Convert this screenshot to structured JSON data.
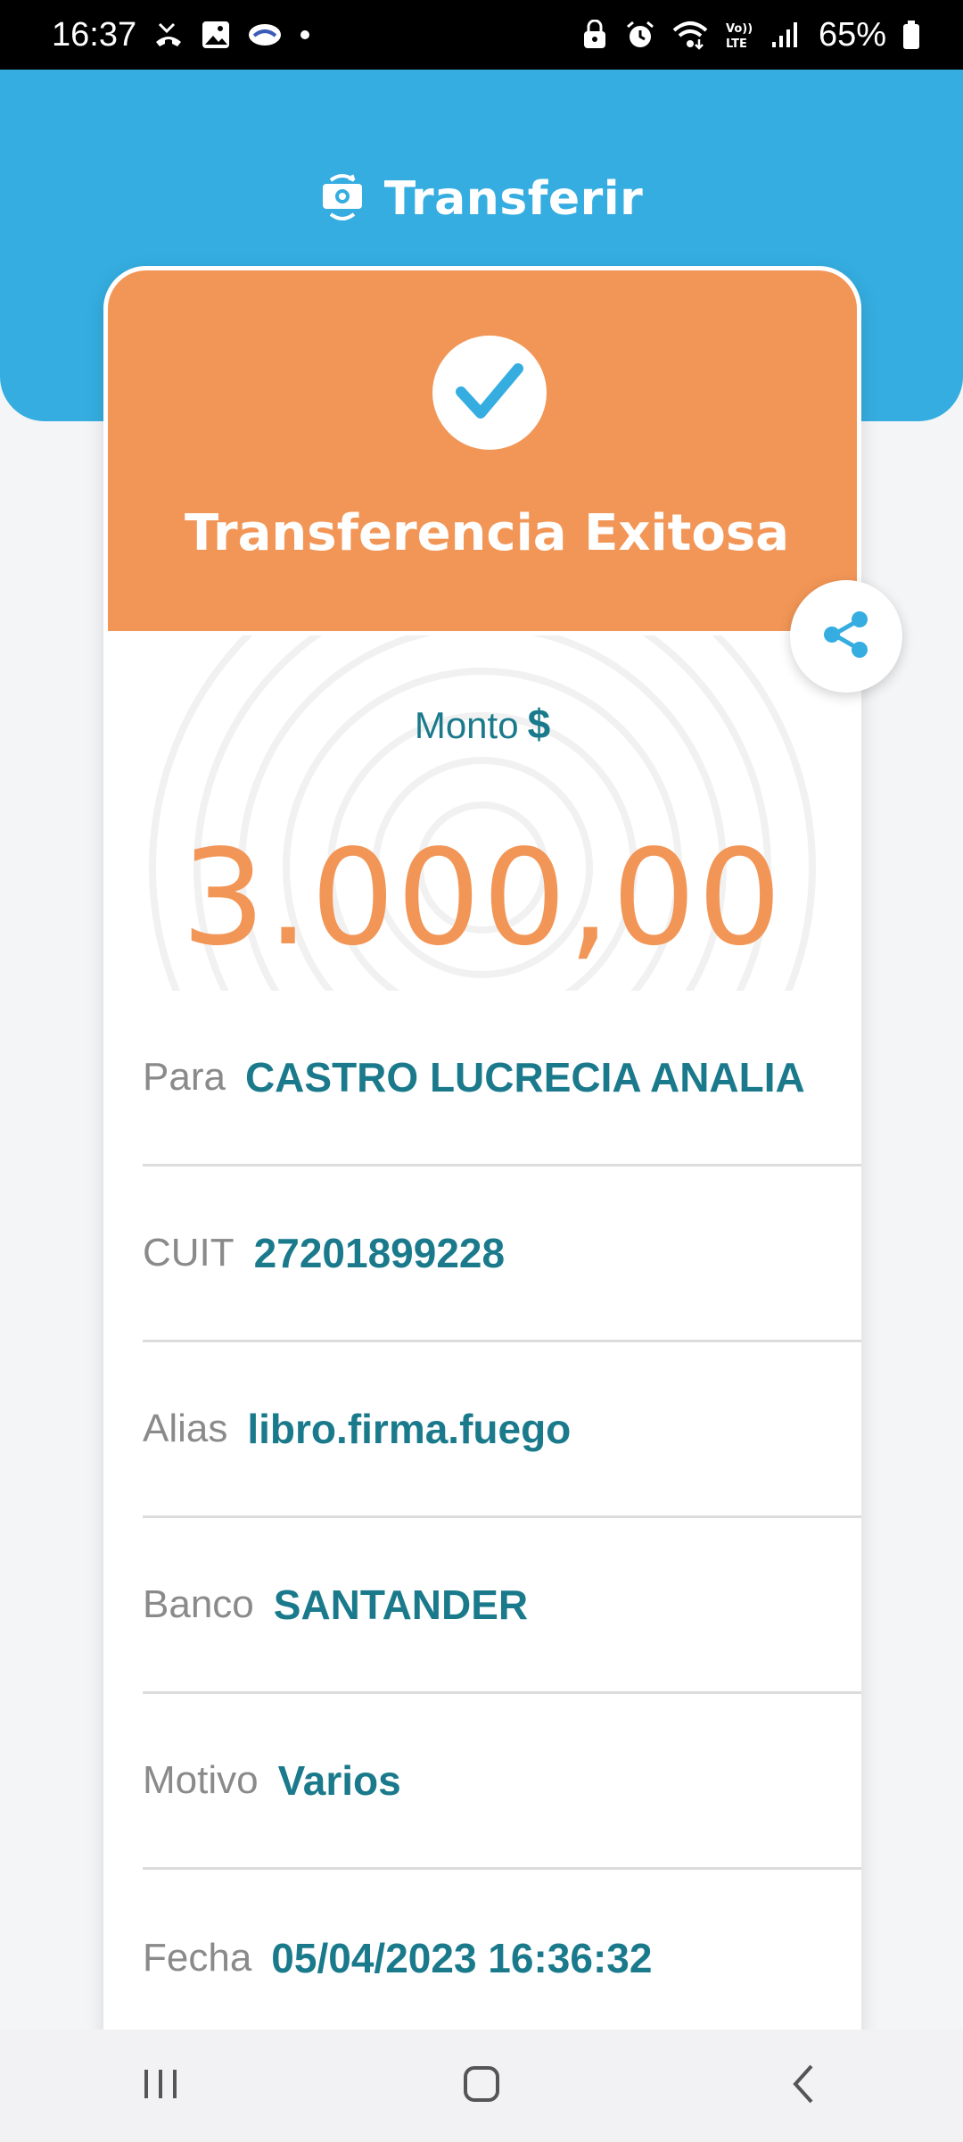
{
  "status_bar": {
    "time": "16:37",
    "battery_percent": "65%",
    "icons": [
      "missed-call-icon",
      "gallery-icon",
      "handshake-icon",
      "dot-icon",
      "vpn-icon",
      "alarm-icon",
      "wifi-icon",
      "volte-icon",
      "signal-icon",
      "battery-icon"
    ],
    "volte_label": "Vo)) LTE"
  },
  "header": {
    "title": "Transferir",
    "icon": "money-transfer-icon"
  },
  "result": {
    "title": "Transferencia Exitosa",
    "icon": "check-icon"
  },
  "amount": {
    "label": "Monto",
    "currency": "$",
    "value": "3.000,00"
  },
  "details": [
    {
      "label": "Para",
      "value": "CASTRO LUCRECIA ANALIA"
    },
    {
      "label": "CUIT",
      "value": "27201899228"
    },
    {
      "label": "Alias",
      "value": "libro.firma.fuego"
    },
    {
      "label": "Banco",
      "value": "SANTANDER"
    },
    {
      "label": "Motivo",
      "value": "Varios"
    },
    {
      "label": "Fecha",
      "value": "05/04/2023 16:36:32"
    }
  ],
  "colors": {
    "header_blue": "#35ade0",
    "success_orange": "#f29657",
    "value_teal": "#1a7a8c",
    "label_gray": "#8a8a8a"
  },
  "nav": [
    "recent-apps-icon",
    "home-icon",
    "back-icon"
  ]
}
